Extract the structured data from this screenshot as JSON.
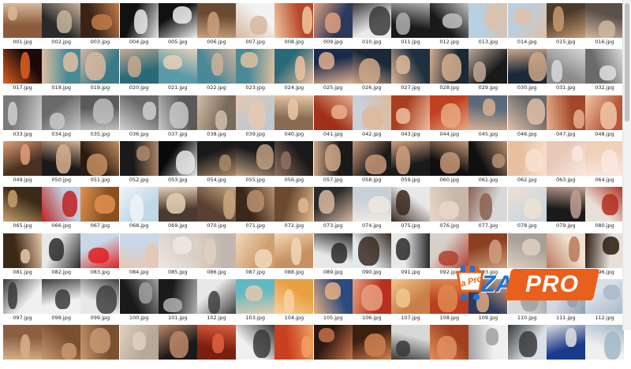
{
  "files": [
    "001.jpg",
    "002.jpg",
    "003.jpg",
    "004.jpg",
    "005.jpg",
    "006.jpg",
    "007.jpg",
    "008.jpg",
    "009.jpg",
    "010.jpg",
    "011.jpg",
    "012.jpg",
    "013.jpg",
    "014.jpg",
    "015.jpg",
    "016.jpg",
    "017.jpg",
    "018.jpg",
    "019.jpg",
    "020.jpg",
    "021.jpg",
    "022.jpg",
    "023.jpg",
    "024.jpg",
    "025.jpg",
    "026.jpg",
    "027.jpg",
    "028.jpg",
    "029.jpg",
    "030.jpg",
    "031.jpg",
    "032.jpg",
    "033.jpg",
    "034.jpg",
    "035.jpg",
    "036.jpg",
    "037.jpg",
    "038.jpg",
    "039.jpg",
    "040.jpg",
    "041.jpg",
    "042.jpg",
    "043.jpg",
    "044.jpg",
    "045.jpg",
    "046.jpg",
    "047.jpg",
    "048.jpg",
    "049.jpg",
    "050.jpg",
    "051.jpg",
    "052.jpg",
    "053.jpg",
    "054.jpg",
    "055.jpg",
    "056.jpg",
    "057.jpg",
    "058.jpg",
    "059.jpg",
    "060.jpg",
    "061.jpg",
    "062.jpg",
    "063.jpg",
    "064.jpg",
    "065.jpg",
    "066.jpg",
    "067.jpg",
    "068.jpg",
    "069.jpg",
    "070.jpg",
    "071.jpg",
    "072.jpg",
    "073.jpg",
    "074.jpg",
    "075.jpg",
    "076.jpg",
    "077.jpg",
    "078.jpg",
    "079.jpg",
    "080.jpg",
    "081.jpg",
    "082.jpg",
    "083.jpg",
    "084.jpg",
    "085.jpg",
    "086.jpg",
    "087.jpg",
    "088.jpg",
    "089.jpg",
    "090.jpg",
    "091.jpg",
    "092.jpg",
    "093.jpg",
    "094.jpg",
    "095.jpg",
    "096.jpg",
    "097.jpg",
    "098.jpg",
    "099.jpg",
    "100.jpg",
    "101.jpg",
    "102.jpg",
    "103.jpg",
    "104.jpg",
    "105.jpg",
    "106.jpg",
    "107.jpg",
    "108.jpg",
    "109.jpg",
    "110.jpg",
    "111.jpg",
    "112.jpg",
    "",
    "",
    "",
    "",
    "",
    "",
    "",
    "",
    "",
    "",
    "",
    "",
    "",
    "",
    "",
    ""
  ],
  "palettes": [
    [
      "#8a5a3c",
      "#d9b89a"
    ],
    [
      "#2a2a2a",
      "#c8b49a"
    ],
    [
      "#3a2418",
      "#c07a4a"
    ],
    [
      "#111111",
      "#e8e8e8"
    ],
    [
      "#111111",
      "#f0f0f0"
    ],
    [
      "#6a4a32",
      "#caa07c"
    ],
    [
      "#f2f2f2",
      "#d7b8a0"
    ],
    [
      "#b7472a",
      "#f0c8a0"
    ],
    [
      "#2a3a5a",
      "#e0a080"
    ],
    [
      "#eaeaea",
      "#3a3a3a"
    ],
    [
      "#1a1a1a",
      "#b0b0b0"
    ],
    [
      "#1a1a1a",
      "#c0c0c0"
    ],
    [
      "#b8d0e0",
      "#e0c0a8"
    ],
    [
      "#b8d0e0",
      "#e0c0a8"
    ],
    [
      "#4a3a2a",
      "#c89a70"
    ],
    [
      "#5a5048",
      "#d0b8a0"
    ],
    [
      "#1a0a0a",
      "#e06020"
    ],
    [
      "#4a8a98",
      "#e0c0a0"
    ],
    [
      "#3a7a88",
      "#d8b8a0"
    ],
    [
      "#2a6a78",
      "#c8a890"
    ],
    [
      "#5a9aa8",
      "#e8d0b8"
    ],
    [
      "#4a8898",
      "#d0b098"
    ],
    [
      "#4a8a98",
      "#e0c0a0"
    ],
    [
      "#2a6a78",
      "#f0c0a0"
    ],
    [
      "#1a2a4a",
      "#e0b090"
    ],
    [
      "#1a2838",
      "#d0a888"
    ],
    [
      "#203040",
      "#e0b898"
    ],
    [
      "#1a2838",
      "#d8b090"
    ],
    [
      "#1a1a1a",
      "#c0a898"
    ],
    [
      "#1a2838",
      "#d0a888"
    ],
    [
      "#8a8a8a",
      "#d8d8d8"
    ],
    [
      "#6a6a6a",
      "#e0e0e0"
    ],
    [
      "#7a7a7a",
      "#d0d0d0"
    ],
    [
      "#6a6a6a",
      "#c8c8c8"
    ],
    [
      "#5a5a5a",
      "#c0c0c0"
    ],
    [
      "#6a6a6a",
      "#d0d0d0"
    ],
    [
      "#5a5a5a",
      "#c8c8c8"
    ],
    [
      "#7a6a5a",
      "#d0c0a8"
    ],
    [
      "#c0c8d0",
      "#e8c8b0"
    ],
    [
      "#8a6a50",
      "#e8c8a8"
    ],
    [
      "#a03018",
      "#e8b090"
    ],
    [
      "#c8d0d8",
      "#e0b898"
    ],
    [
      "#a84020",
      "#f0c0a0"
    ],
    [
      "#c04020",
      "#e8a880"
    ],
    [
      "#5a6a7a",
      "#d8b090"
    ],
    [
      "#6a6a6a",
      "#e0c0a8"
    ],
    [
      "#a04828",
      "#e8b090"
    ],
    [
      "#b85838",
      "#f0c8a8"
    ],
    [
      "#4a3020",
      "#e0a078"
    ],
    [
      "#1a1a1a",
      "#d8b090"
    ],
    [
      "#2a1a10",
      "#c89060"
    ],
    [
      "#1a1a1a",
      "#b08868"
    ],
    [
      "#0a0a0a",
      "#e8e8e8"
    ],
    [
      "#1a1a1a",
      "#a88868"
    ],
    [
      "#1a1a1a",
      "#c0a080"
    ],
    [
      "#1a1a1a",
      "#907060"
    ],
    [
      "#1a1a1a",
      "#d0a888"
    ],
    [
      "#1a1a1a",
      "#c89878"
    ],
    [
      "#1a1a1a",
      "#d0a080"
    ],
    [
      "#101010",
      "#c89878"
    ],
    [
      "#101010",
      "#b89070"
    ],
    [
      "#e8c0a0",
      "#f8e0d0"
    ],
    [
      "#e8c8b8",
      "#f8e8e0"
    ],
    [
      "#f0d0b8",
      "#fae8e0"
    ],
    [
      "#3a2a18",
      "#c8a070"
    ],
    [
      "#c0d0e0",
      "#c02020"
    ],
    [
      "#8a5020",
      "#e09050"
    ],
    [
      "#c0d8e8",
      "#f0f4f8"
    ],
    [
      "#4a3a30",
      "#e8d0b8"
    ],
    [
      "#5a4030",
      "#c8a880"
    ],
    [
      "#3a2818",
      "#b89070"
    ],
    [
      "#6a4a30",
      "#e0b890"
    ],
    [
      "#2a2a2a",
      "#d8b8a0"
    ],
    [
      "#c8d0d8",
      "#f0e8e0"
    ],
    [
      "#e8e8e8",
      "#3a2a20"
    ],
    [
      "#c8b8a8",
      "#e8d8c8"
    ],
    [
      "#d8d8d8",
      "#8a6050"
    ],
    [
      "#d0d8e0",
      "#f0e0d0"
    ],
    [
      "#1a1a1a",
      "#c0a090"
    ],
    [
      "#e8e0d8",
      "#b03020"
    ],
    [
      "#3a2818",
      "#e8c8a8"
    ],
    [
      "#e8e8e8",
      "#2a2a2a"
    ],
    [
      "#c8d8e8",
      "#e02020"
    ],
    [
      "#c8d8e8",
      "#e8c8b0"
    ],
    [
      "#d8d0c8",
      "#f0e8e0"
    ],
    [
      "#c0b8b0",
      "#e0d0c0"
    ],
    [
      "#d0a070",
      "#f0d8c0"
    ],
    [
      "#c89060",
      "#f0d8b8"
    ],
    [
      "#e8e8e8",
      "#2a2a2a"
    ],
    [
      "#e0e8f0",
      "#3a2a20"
    ],
    [
      "#e8e8e8",
      "#2a2a2a"
    ],
    [
      "#d8d0c8",
      "#b04030"
    ],
    [
      "#8a4020",
      "#d0a080"
    ],
    [
      "#a8a098",
      "#e0d0c0"
    ],
    [
      "#f0e0d0",
      "#b87858"
    ],
    [
      "#e8e0d8",
      "#2a1a10"
    ],
    [
      "#f0f0f0",
      "#3a3a3a"
    ],
    [
      "#f0f0f0",
      "#3a3a3a"
    ],
    [
      "#e8e8e8",
      "#404040"
    ],
    [
      "#1a1a1a",
      "#a0a0a0"
    ],
    [
      "#1a1a1a",
      "#b0b0b0"
    ],
    [
      "#e8e8e8",
      "#404040"
    ],
    [
      "#60b8c0",
      "#e0c8b0"
    ],
    [
      "#e8a040",
      "#f8d0a0"
    ],
    [
      "#2a4a80",
      "#e8b080"
    ],
    [
      "#b83020",
      "#e8a080"
    ],
    [
      "#c88048",
      "#f0c890"
    ],
    [
      "#b84020",
      "#e08850"
    ],
    [
      "#2a3a60",
      "#e0a880"
    ],
    [
      "#d8d8d8",
      "#a0a0a0"
    ],
    [
      "#d0d8e0",
      "#90a0b0"
    ],
    [
      "#d8e0e8",
      "#a8b8c8"
    ],
    [
      "#8a6040",
      "#d8b088"
    ],
    [
      "#7a5030",
      "#c89870"
    ],
    [
      "#7a5030",
      "#c89870"
    ],
    [
      "#b8a898",
      "#e0d0c0"
    ],
    [
      "#1a1a1a",
      "#c08868"
    ],
    [
      "#7a2010",
      "#e06040"
    ],
    [
      "#f0f0f0",
      "#3a3a3a"
    ],
    [
      "#c84020",
      "#f0a060"
    ],
    [
      "#2a1810",
      "#c87048"
    ],
    [
      "#3a2010",
      "#d08050"
    ],
    [
      "#d8d8d8",
      "#3a3a3a"
    ],
    [
      "#a04020",
      "#e09060"
    ],
    [
      "#f0f0f0",
      "#a0a0a0"
    ],
    [
      "#d8e0e8",
      "#3a3a3a"
    ],
    [
      "#1a3a8a",
      "#e0e0e0"
    ],
    [
      "#f0f0f0",
      "#a0b8c8"
    ]
  ],
  "brand": {
    "badge_text": "a Pro",
    "za": "ZA",
    "pro": "PRO",
    "colors": {
      "blue": "#1e73d8",
      "orange": "#e8601c"
    }
  }
}
